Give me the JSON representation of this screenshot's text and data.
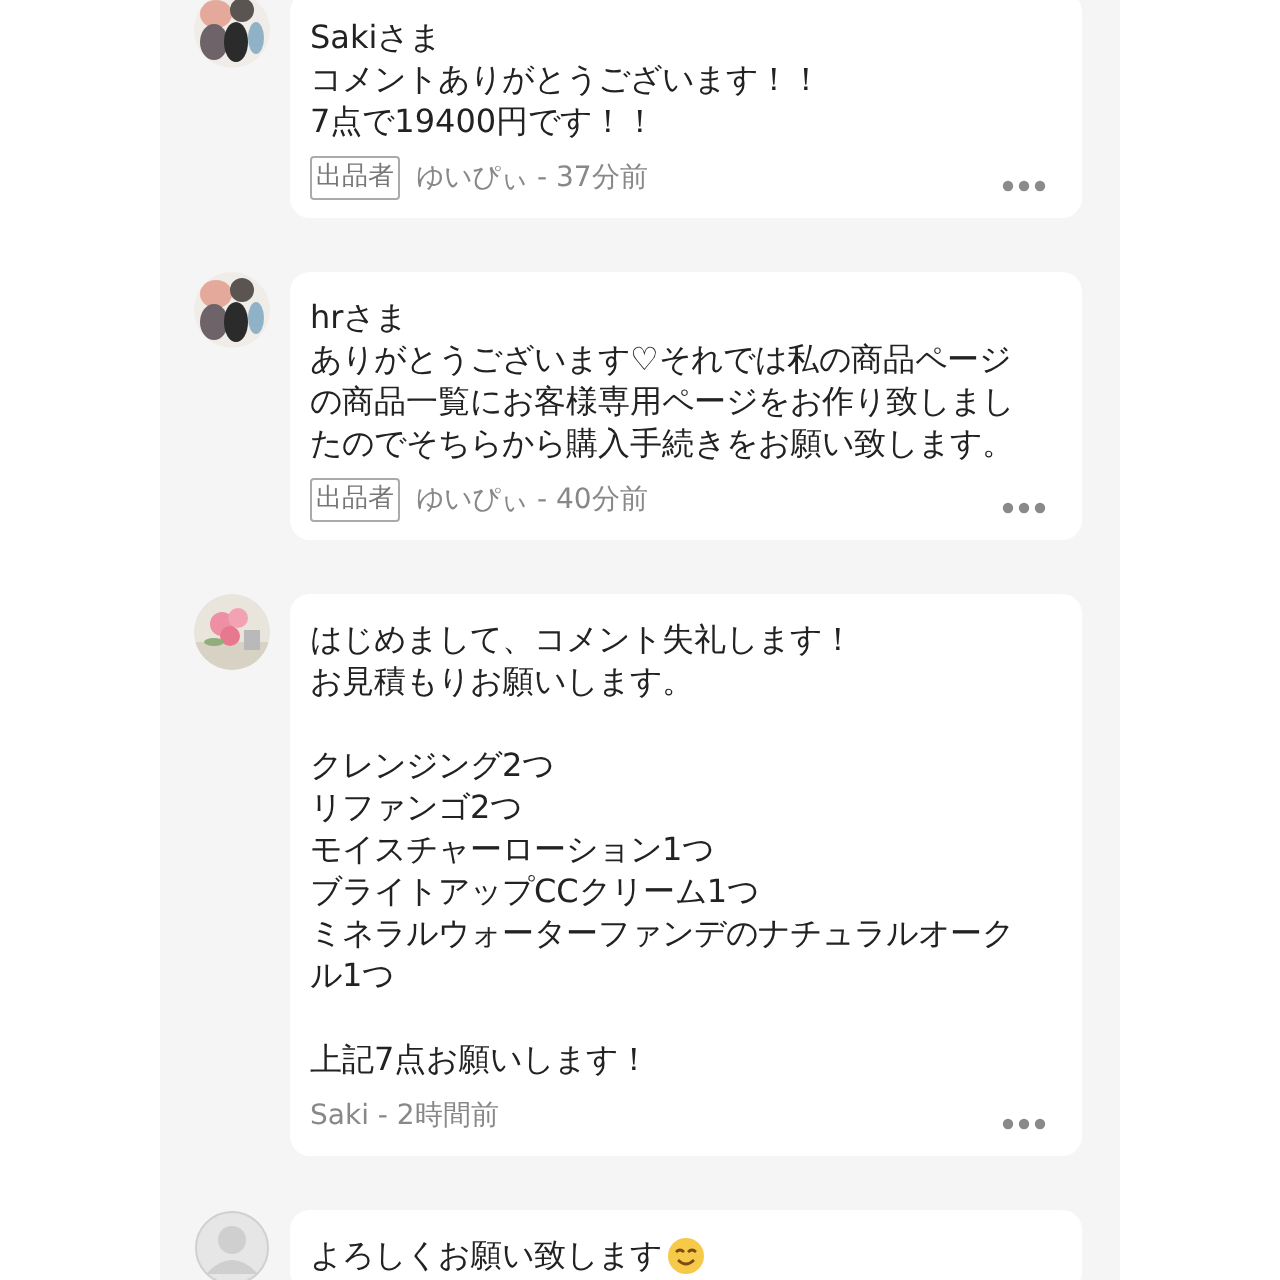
{
  "comments": [
    {
      "avatar": {
        "kind": "picture"
      },
      "paragraphs": [
        [
          "Sakiさま",
          "コメントありがとうございます！！",
          "7点で19400円です！！"
        ]
      ],
      "badge": "出品者",
      "meta": "ゆいぴぃ - 37分前"
    },
    {
      "avatar": {
        "kind": "picture"
      },
      "paragraphs": [
        [
          "hrさま",
          "ありがとうございます♡それでは私の商品ページ",
          "の商品一覧にお客様専用ページをお作り致しまし",
          "たのでそちらから購入手続きをお願い致します。"
        ]
      ],
      "badge": "出品者",
      "meta": "ゆいぴぃ - 40分前"
    },
    {
      "avatar": {
        "kind": "picture"
      },
      "paragraphs": [
        [
          "はじめまして、コメント失礼します！",
          "お見積もりお願いします。"
        ],
        [
          "クレンジング2つ",
          "リファンゴ2つ",
          "モイスチャーローション1つ",
          "ブライトアップCCクリーム1つ",
          "ミネラルウォーターファンデのナチュラルオーク",
          "ル1つ"
        ],
        [
          "上記7点お願いします！"
        ]
      ],
      "meta": "Saki - 2時間前"
    },
    {
      "avatar": {
        "kind": "placeholder"
      },
      "paragraphs": [
        [
          "よろしくお願い致します"
        ]
      ],
      "emoji": {
        "kind": "smile"
      }
    }
  ]
}
